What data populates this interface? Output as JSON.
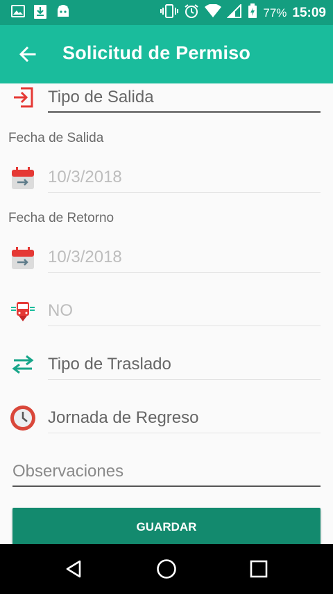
{
  "status_bar": {
    "battery": "77%",
    "time": "15:09"
  },
  "app_bar": {
    "title": "Solicitud de Permiso"
  },
  "form": {
    "tipo_salida": {
      "placeholder": "Tipo de Salida"
    },
    "fecha_salida": {
      "label": "Fecha de Salida",
      "value": "10/3/2018"
    },
    "fecha_retorno": {
      "label": "Fecha de Retorno",
      "value": "10/3/2018"
    },
    "transporte": {
      "value": "NO"
    },
    "tipo_traslado": {
      "placeholder": "Tipo de Traslado"
    },
    "jornada_regreso": {
      "placeholder": "Jornada de Regreso"
    },
    "observaciones": {
      "placeholder": "Observaciones"
    },
    "save_label": "GUARDAR"
  },
  "colors": {
    "status_bar": "#149e80",
    "app_bar": "#1abc9c",
    "button": "#138a6e",
    "icon_red": "#e53935"
  },
  "icons": {
    "back": "arrow-left-icon",
    "exit": "exit-icon",
    "calendar": "calendar-icon",
    "bus": "bus-icon",
    "swap": "swap-arrows-icon",
    "clock": "clock-icon"
  }
}
